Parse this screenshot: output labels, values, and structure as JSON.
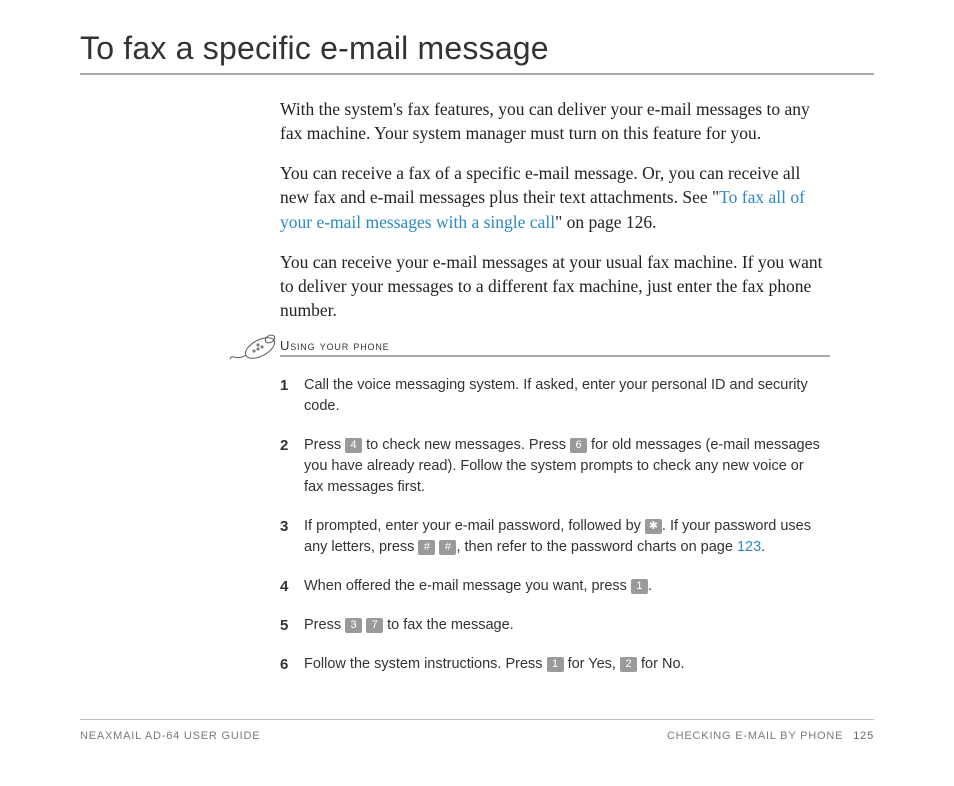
{
  "title": "To fax a specific e-mail message",
  "paragraphs": {
    "p1": "With the system's fax features, you can deliver your e-mail messages to any fax machine. Your system manager must turn on this feature for you.",
    "p2a": "You can receive a fax of a specific e-mail message. Or, you can receive all new fax and e-mail messages plus their text attachments. See \"",
    "p2_link": "To fax all of your e-mail messages with a single call",
    "p2b": "\" on page 126.",
    "p3": "You can receive your e-mail messages at your usual fax machine. If you want to deliver your messages to a different fax machine, just enter the fax phone number."
  },
  "section_heading": "Using your phone",
  "keys": {
    "k4": "4",
    "k6": "6",
    "kstar": "✱",
    "khash1": "#",
    "khash2": "#",
    "k1a": "1",
    "k3": "3",
    "k7": "7",
    "k1b": "1",
    "k2": "2"
  },
  "steps": {
    "s1": "Call the voice messaging system. If asked, enter your personal ID and security code.",
    "s2a": "Press ",
    "s2b": " to check new messages. Press ",
    "s2c": " for old messages (e-mail messages you have already read). Follow the system prompts to check any new voice or fax messages first.",
    "s3a": "If prompted, enter your e-mail password, followed by ",
    "s3b": ". If your password uses any letters, press ",
    "s3c": " ",
    "s3d": ", then refer to the password charts on page ",
    "s3_link": "123",
    "s3e": ".",
    "s4a": "When offered the e-mail message you want, press ",
    "s4b": ".",
    "s5a": "Press ",
    "s5b": " ",
    "s5c": " to fax the message.",
    "s6a": "Follow the system instructions. Press ",
    "s6b": " for Yes, ",
    "s6c": " for No."
  },
  "step_nums": {
    "n1": "1",
    "n2": "2",
    "n3": "3",
    "n4": "4",
    "n5": "5",
    "n6": "6"
  },
  "footer": {
    "left": "NEAXMAIL AD-64 USER GUIDE",
    "right": "CHECKING E-MAIL BY PHONE",
    "page": "125"
  }
}
